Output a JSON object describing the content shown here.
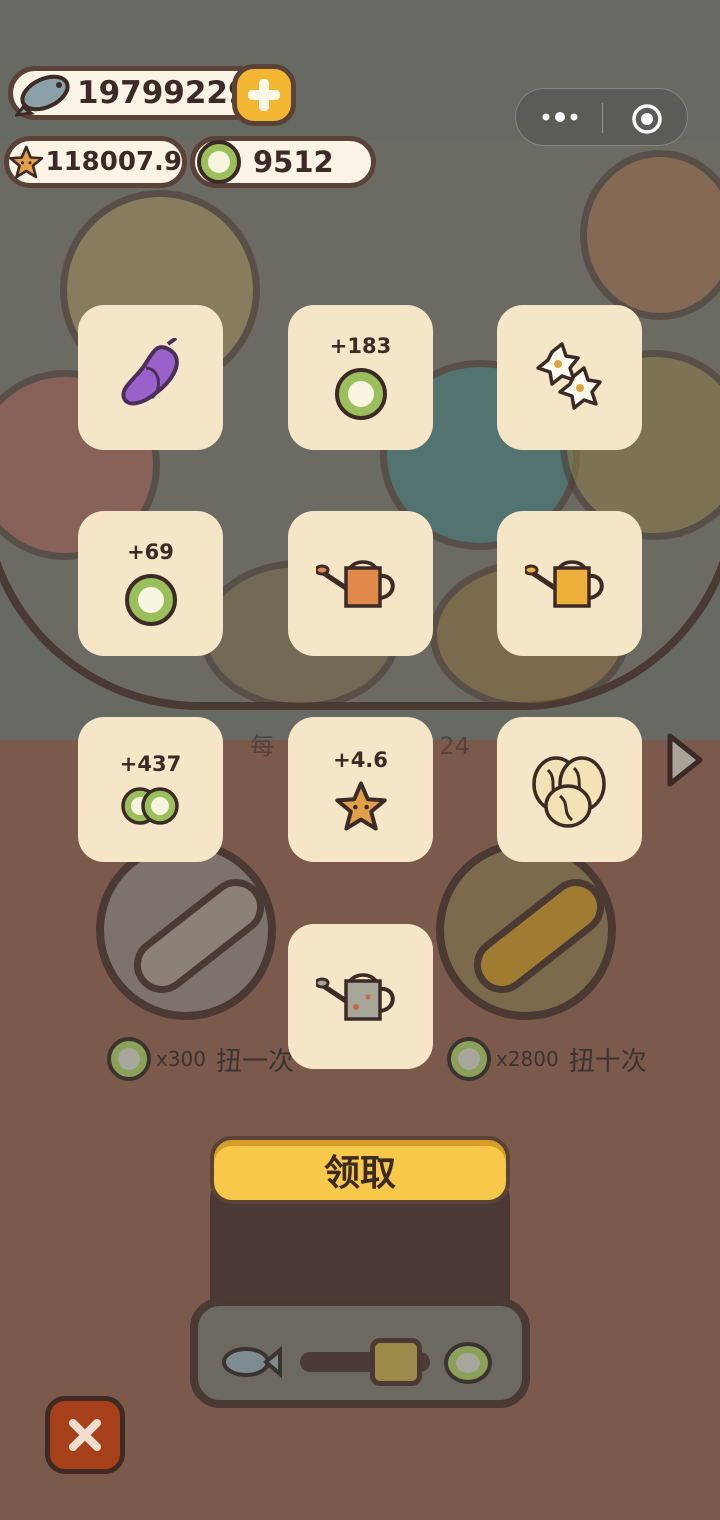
{
  "colors": {
    "tile_bg": "#f5e6c8",
    "button_yellow": "#f7c84a",
    "close_red": "#a6401a",
    "outline": "#5b4238"
  },
  "currencies": {
    "fish": {
      "icon": "fish-icon",
      "value": "19799229"
    },
    "star": {
      "icon": "star-icon",
      "value": "118007.9"
    },
    "coin": {
      "icon": "coin-icon",
      "value": "9512"
    }
  },
  "background": {
    "partial_label_left": "每",
    "partial_label_right": "24"
  },
  "gacha": {
    "single": {
      "multiplier": "x300",
      "label": "扭一次"
    },
    "ten": {
      "multiplier": "x2800",
      "label": "扭十次"
    }
  },
  "rewards": [
    {
      "icon": "eggplant-icon",
      "amount": ""
    },
    {
      "icon": "coin-icon",
      "amount": "+183"
    },
    {
      "icon": "flower-icon",
      "amount": ""
    },
    {
      "icon": "coin-icon",
      "amount": "+69"
    },
    {
      "icon": "orange-watering-can-icon",
      "amount": ""
    },
    {
      "icon": "yellow-watering-can-icon",
      "amount": ""
    },
    {
      "icon": "double-coin-icon",
      "amount": "+437"
    },
    {
      "icon": "star-icon",
      "amount": "+4.6"
    },
    {
      "icon": "walnut-icon",
      "amount": ""
    },
    {
      "icon": "gray-watering-can-icon",
      "amount": ""
    }
  ],
  "claim_label": "领取"
}
